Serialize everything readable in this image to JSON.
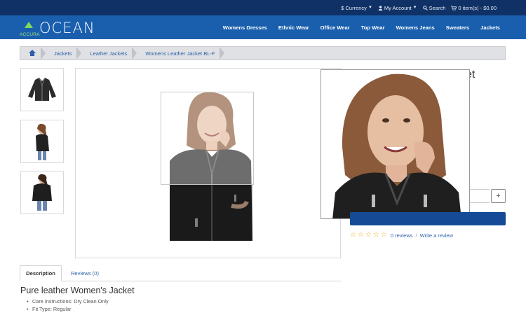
{
  "topbar": {
    "currency": "$ Currency",
    "account": "My Account",
    "search": "Search",
    "cart": "0 item(s) - $0.00"
  },
  "logo": {
    "small": "ACCURA",
    "big": "OCEAN"
  },
  "nav": [
    "Womens Dresses",
    "Ethnic Wear",
    "Office Wear",
    "Top Wear",
    "Womens Jeans",
    "Sweaters",
    "Jackets"
  ],
  "breadcrumb": {
    "items": [
      "Jackets",
      "Leather Jackets",
      "Womens Leather Jacket BL-F"
    ]
  },
  "product": {
    "title_fragment": "cket",
    "quantity_plus": "+",
    "reviews": "0 reviews",
    "separator": "/",
    "write_review": "Write a review",
    "rating_stars": 0
  },
  "tabs": {
    "description": "Description",
    "reviews": "Reviews (0)"
  },
  "description": {
    "title": "Pure leather Women's Jacket",
    "bullets": [
      "Care Instructions: Dry Clean Only",
      "Fit Type: Regular"
    ]
  },
  "colors": {
    "topbar": "#0f3166",
    "header": "#1a5fae",
    "cart_button": "#154b96",
    "star": "#e6b422",
    "link": "#2a5ea8"
  }
}
